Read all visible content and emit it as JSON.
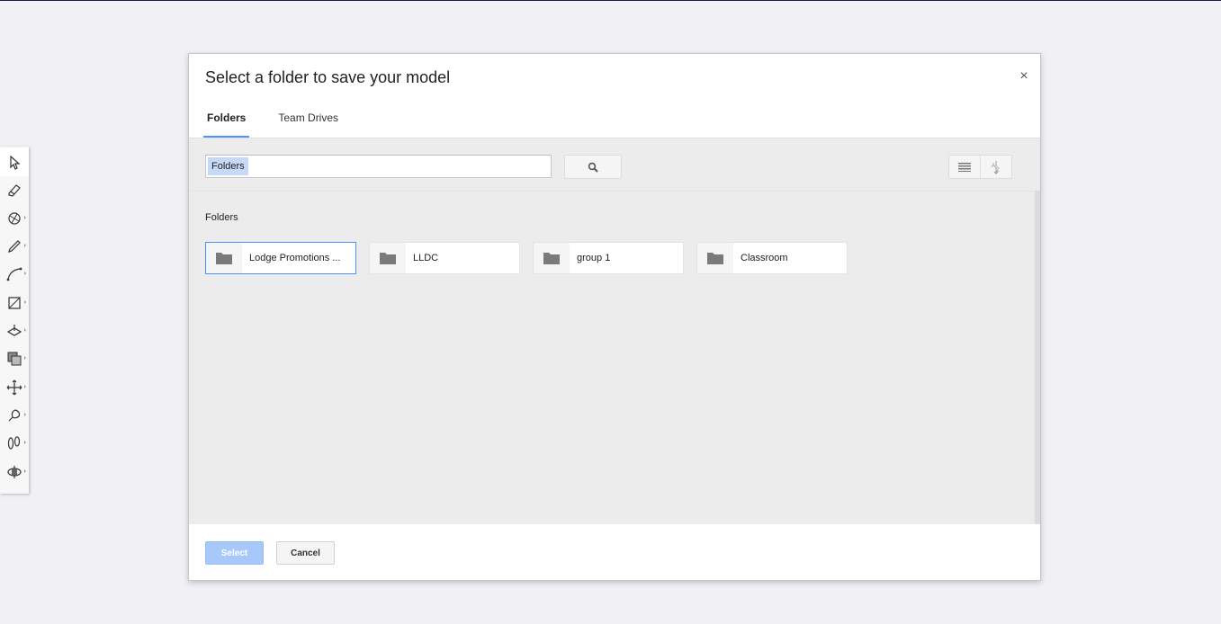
{
  "dialog": {
    "title": "Select a folder to save your model",
    "close_label": "×",
    "tabs": [
      {
        "label": "Folders",
        "active": true
      },
      {
        "label": "Team Drives",
        "active": false
      }
    ],
    "search": {
      "chip": "Folders",
      "value": ""
    },
    "section_label": "Folders",
    "folders": [
      {
        "name": "Lodge Promotions ...",
        "selected": true
      },
      {
        "name": "LLDC",
        "selected": false
      },
      {
        "name": "group 1",
        "selected": false
      },
      {
        "name": "Classroom",
        "selected": false
      }
    ],
    "select_label": "Select",
    "cancel_label": "Cancel"
  },
  "toolbar": {
    "tools": [
      {
        "icon": "select-arrow-icon"
      },
      {
        "icon": "eraser-icon"
      },
      {
        "icon": "paint-bucket-icon"
      },
      {
        "icon": "pencil-icon"
      },
      {
        "icon": "arc-icon"
      },
      {
        "icon": "rectangle-icon"
      },
      {
        "icon": "push-pull-icon"
      },
      {
        "icon": "offset-icon"
      },
      {
        "icon": "move-icon"
      },
      {
        "icon": "tape-measure-icon"
      },
      {
        "icon": "walk-icon"
      },
      {
        "icon": "orbit-icon"
      }
    ]
  },
  "colors": {
    "accent": "#4d90fe",
    "select_button_disabled": "#a8c8f9",
    "body_background": "#ececec",
    "folder_icon": "#7a7a7a"
  }
}
